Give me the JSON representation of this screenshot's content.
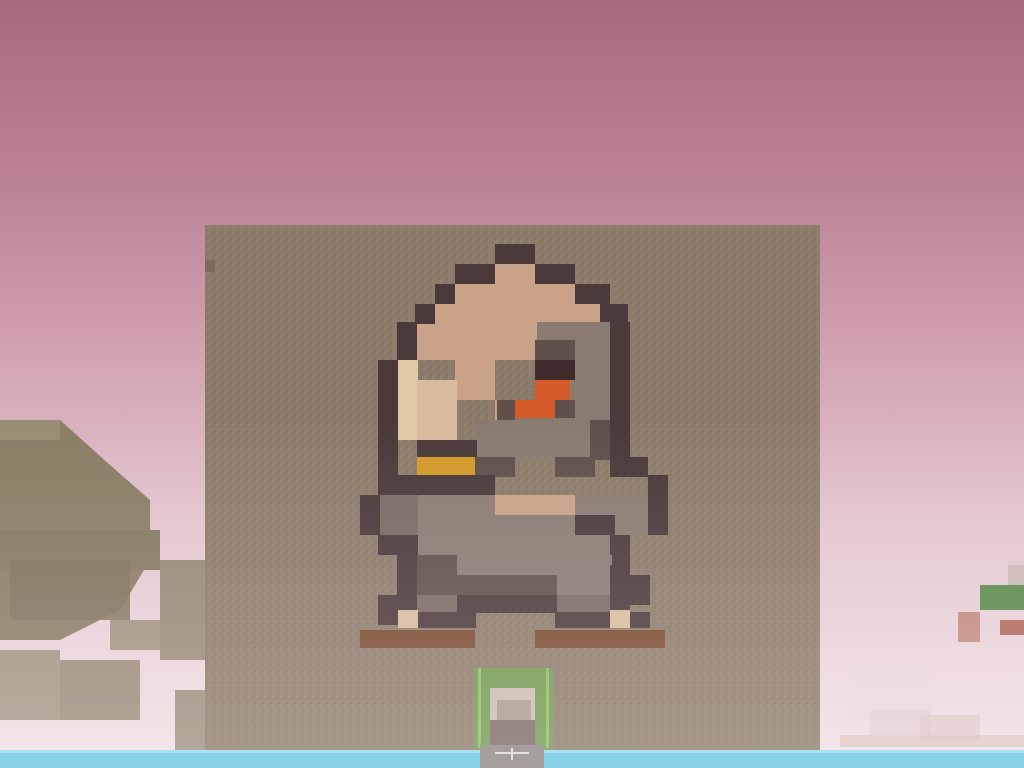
{
  "scene": {
    "description_hidden": "",
    "palette": {
      "sky_top": "#a56a80",
      "sky_bottom": "#efe3e6",
      "wall": "#8b7c6b",
      "outline": "#4a3a3a",
      "skin": "#c9a287",
      "skin_light": "#d9bc9f",
      "hair_light": "#e0c8a2",
      "body_gray": "#7a6a63",
      "body_dark": "#5f504b",
      "collar": "#d39a2b",
      "eye_orange": "#d45a2a",
      "eye_dark": "#3d2c2a",
      "shoe": "#7a4a2e",
      "door_frame": "#6f9a4f",
      "door_inner": "#c9bdb0",
      "water": "#5ec7e0",
      "ruin": "#8a7e66",
      "tree_green": "#5a8a4a",
      "tree_trunk": "#b06a5a"
    }
  }
}
